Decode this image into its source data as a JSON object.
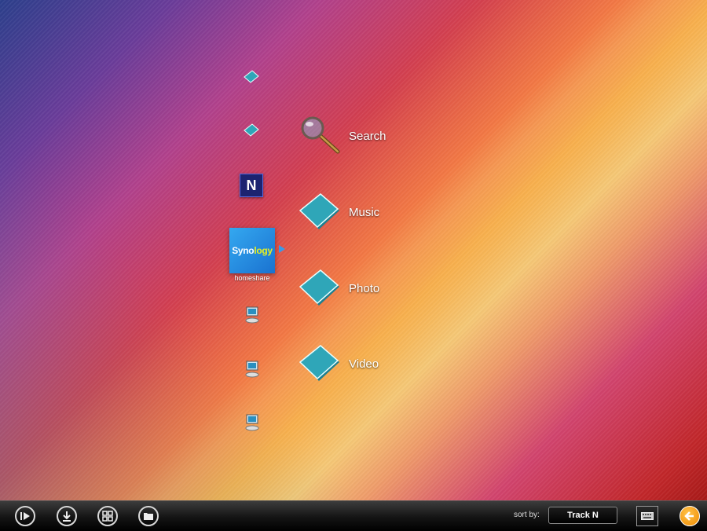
{
  "sources": {
    "items": [
      {
        "icon": "folder-icon"
      },
      {
        "icon": "folder-icon"
      },
      {
        "icon": "network-icon",
        "badge": "N"
      },
      {
        "icon": "synology-icon",
        "brand_a": "Syno",
        "brand_b": "logy",
        "caption": "homeshare",
        "selected": true
      },
      {
        "icon": "computer-icon"
      },
      {
        "icon": "computer-icon"
      },
      {
        "icon": "computer-icon"
      }
    ]
  },
  "menu": {
    "items": [
      {
        "label": "Search",
        "icon": "magnifier-icon"
      },
      {
        "label": "Music",
        "icon": "folder-icon"
      },
      {
        "label": "Photo",
        "icon": "folder-icon"
      },
      {
        "label": "Video",
        "icon": "folder-icon"
      }
    ]
  },
  "toolbar": {
    "buttons": [
      {
        "icon": "play-icon"
      },
      {
        "icon": "download-icon"
      },
      {
        "icon": "grid-icon"
      },
      {
        "icon": "folder-icon"
      }
    ],
    "sort_label": "sort by:",
    "sort_value": "Track N",
    "keyboard_icon": "keyboard-icon",
    "back_icon": "back-arrow-icon"
  },
  "colors": {
    "accent_blue": "#3a9ae8",
    "folder_teal": "#2fa6b8",
    "back_orange": "#f7a21b"
  }
}
